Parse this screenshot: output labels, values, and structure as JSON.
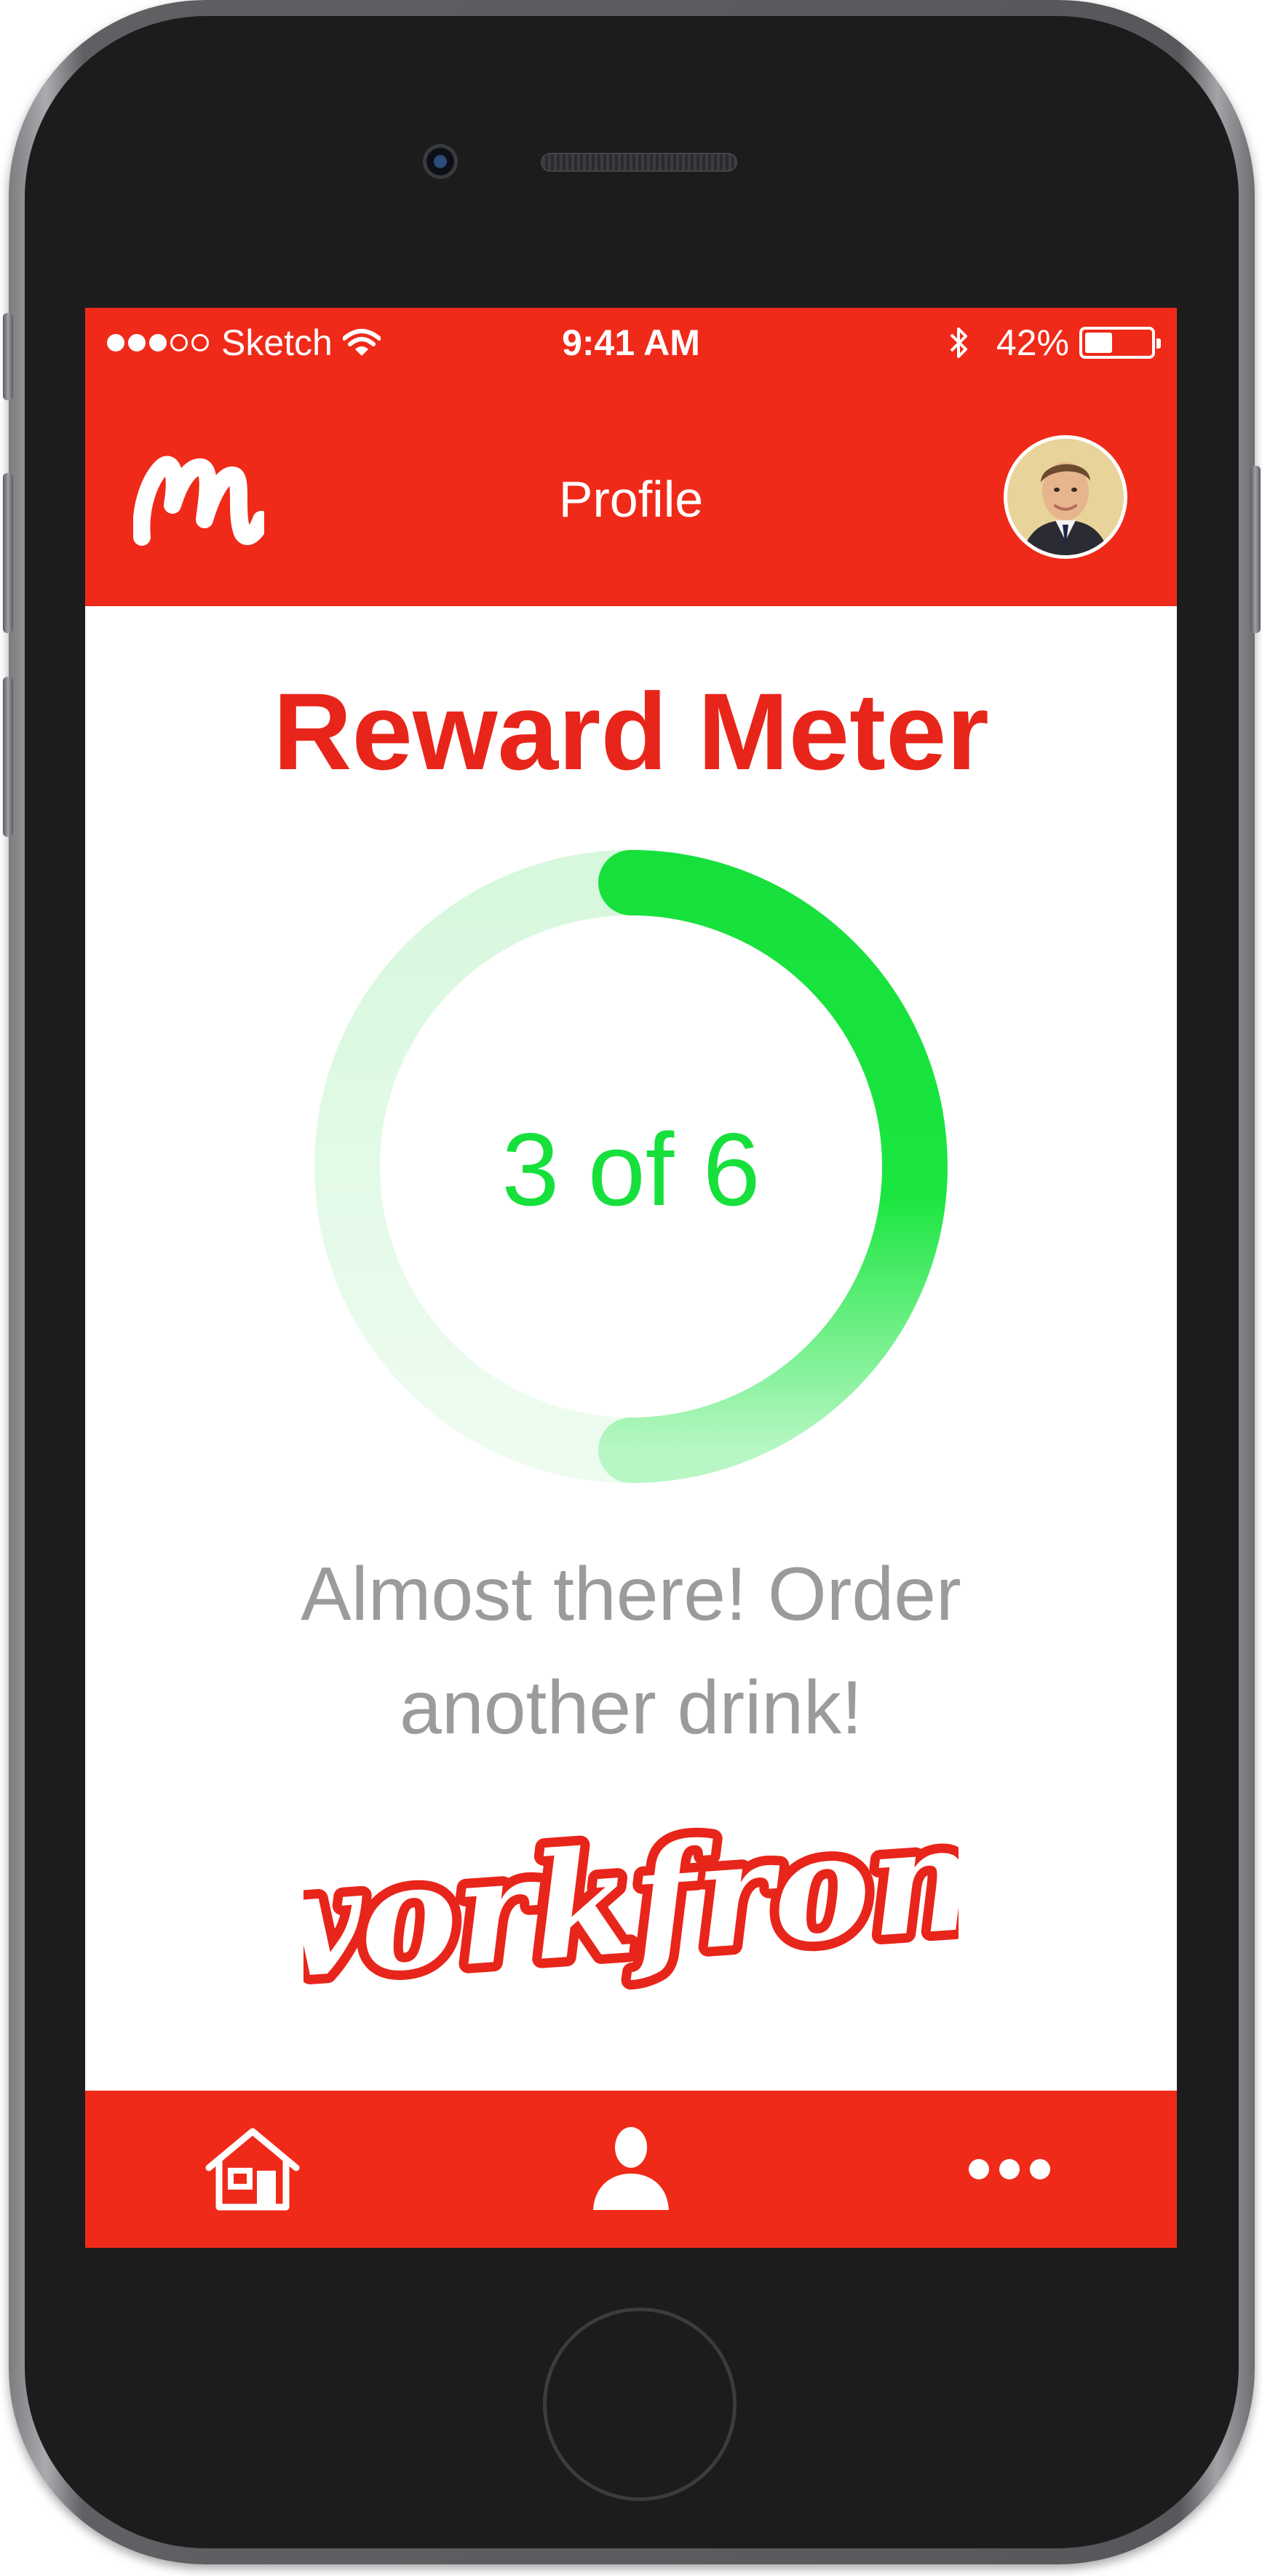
{
  "status_bar": {
    "carrier": "Sketch",
    "time": "9:41 AM",
    "battery": "42%",
    "battery_level": 0.42
  },
  "nav_bar": {
    "title": "Profile"
  },
  "reward": {
    "title": "Reward Meter",
    "progress_text": "3 of 6",
    "current": 3,
    "total": 6,
    "message_line1": "Almost there! Order",
    "message_line2": "another drink!"
  },
  "brand": {
    "wordmark": "workfrom"
  },
  "tab_bar": {
    "icons": [
      "home-icon",
      "profile-icon",
      "more-icon"
    ]
  },
  "colors": {
    "brand_red": "#f02a19",
    "title_red": "#e8251a",
    "meter_green": "#17e03c",
    "meter_track": "#d9f9df",
    "message_gray": "#9b9b9b"
  }
}
